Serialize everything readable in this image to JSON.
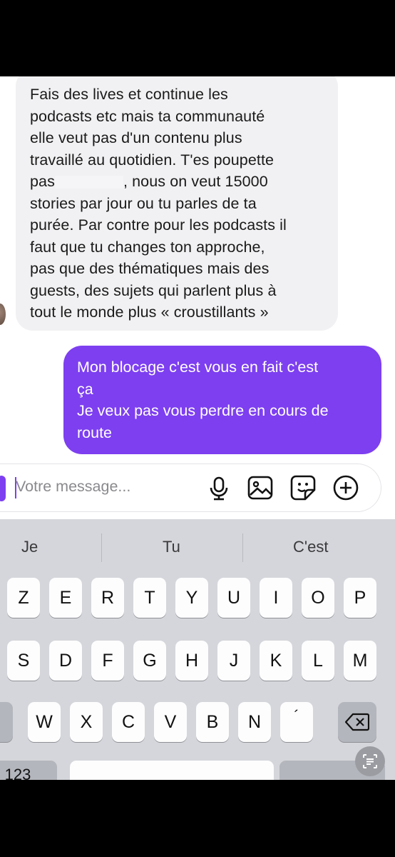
{
  "incoming_message": {
    "lines": [
      "Fais des lives et continue les",
      "podcasts etc mais ta communauté",
      "elle veut pas d'un contenu plus",
      "travaillé au quotidien. T'es poupette",
      "pas",
      ", nous on veut 15000",
      "stories par jour ou tu parles de ta",
      "purée. Par contre pour les podcasts il",
      "faut que tu changes ton approche,",
      "pas que des thématiques mais des",
      "guests, des sujets qui parlent plus à",
      "tout le monde plus « croustillants »"
    ]
  },
  "outgoing_message": {
    "lines": [
      "Mon blocage c'est vous en fait c'est",
      "ça",
      "Je veux pas vous perdre en cours de",
      "route"
    ]
  },
  "composer": {
    "placeholder": "Votre message...",
    "icons": [
      "microphone-icon",
      "image-icon",
      "sticker-icon",
      "plus-circle-icon"
    ]
  },
  "keyboard": {
    "suggestions": [
      "Je",
      "Tu",
      "C'est"
    ],
    "row1": [
      "Z",
      "E",
      "R",
      "T",
      "Y",
      "U",
      "I",
      "O",
      "P"
    ],
    "row2": [
      "S",
      "D",
      "F",
      "G",
      "H",
      "J",
      "K",
      "L",
      "M"
    ],
    "row3": [
      "W",
      "X",
      "C",
      "V",
      "B",
      "N",
      "´"
    ],
    "numbers_key": "123"
  },
  "colors": {
    "accent": "#7d3ff0",
    "incoming_bubble": "#f1f1f3",
    "keyboard_bg": "#d5d6db"
  }
}
